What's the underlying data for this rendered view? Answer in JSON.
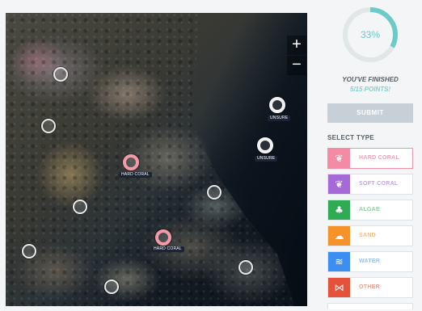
{
  "map": {
    "zoom_in_label": "+",
    "zoom_out_label": "−",
    "tags": {
      "unsure_1": "UNSURE",
      "unsure_2": "UNSURE",
      "coral_1": "HARD CORAL",
      "coral_2": "HARD CORAL"
    }
  },
  "progress": {
    "percent_label": "33%",
    "fraction": 0.33,
    "finished_label": "YOU'VE FINISHED",
    "points_label": "5/15 POINTS!"
  },
  "actions": {
    "submit_label": "SUBMIT"
  },
  "select_type": {
    "heading": "SELECT TYPE",
    "types": [
      {
        "label": "HARD CORAL",
        "color": "#f48ba6",
        "icon": "coral-icon",
        "glyph": "❦",
        "text_color": "#f3a0b4"
      },
      {
        "label": "SOFT CORAL",
        "color": "#a56ad8",
        "icon": "soft-coral-icon",
        "glyph": "❦",
        "text_color": "#c2a5e3"
      },
      {
        "label": "ALGAE",
        "color": "#2eab53",
        "icon": "algae-icon",
        "glyph": "♣",
        "text_color": "#8fcf9f"
      },
      {
        "label": "SAND",
        "color": "#f5922a",
        "icon": "sand-icon",
        "glyph": "☁",
        "text_color": "#f6bd82"
      },
      {
        "label": "WATER",
        "color": "#3c8ff0",
        "icon": "water-icon",
        "glyph": "≋",
        "text_color": "#94c0f2"
      },
      {
        "label": "OTHER",
        "color": "#e5523c",
        "icon": "fish-icon",
        "glyph": "⋈",
        "text_color": "#ee9d8f"
      }
    ]
  },
  "colors": {
    "accent": "#6ccbc8",
    "ring_track": "#e1e6e9",
    "selected_border": "#f28fa8"
  }
}
